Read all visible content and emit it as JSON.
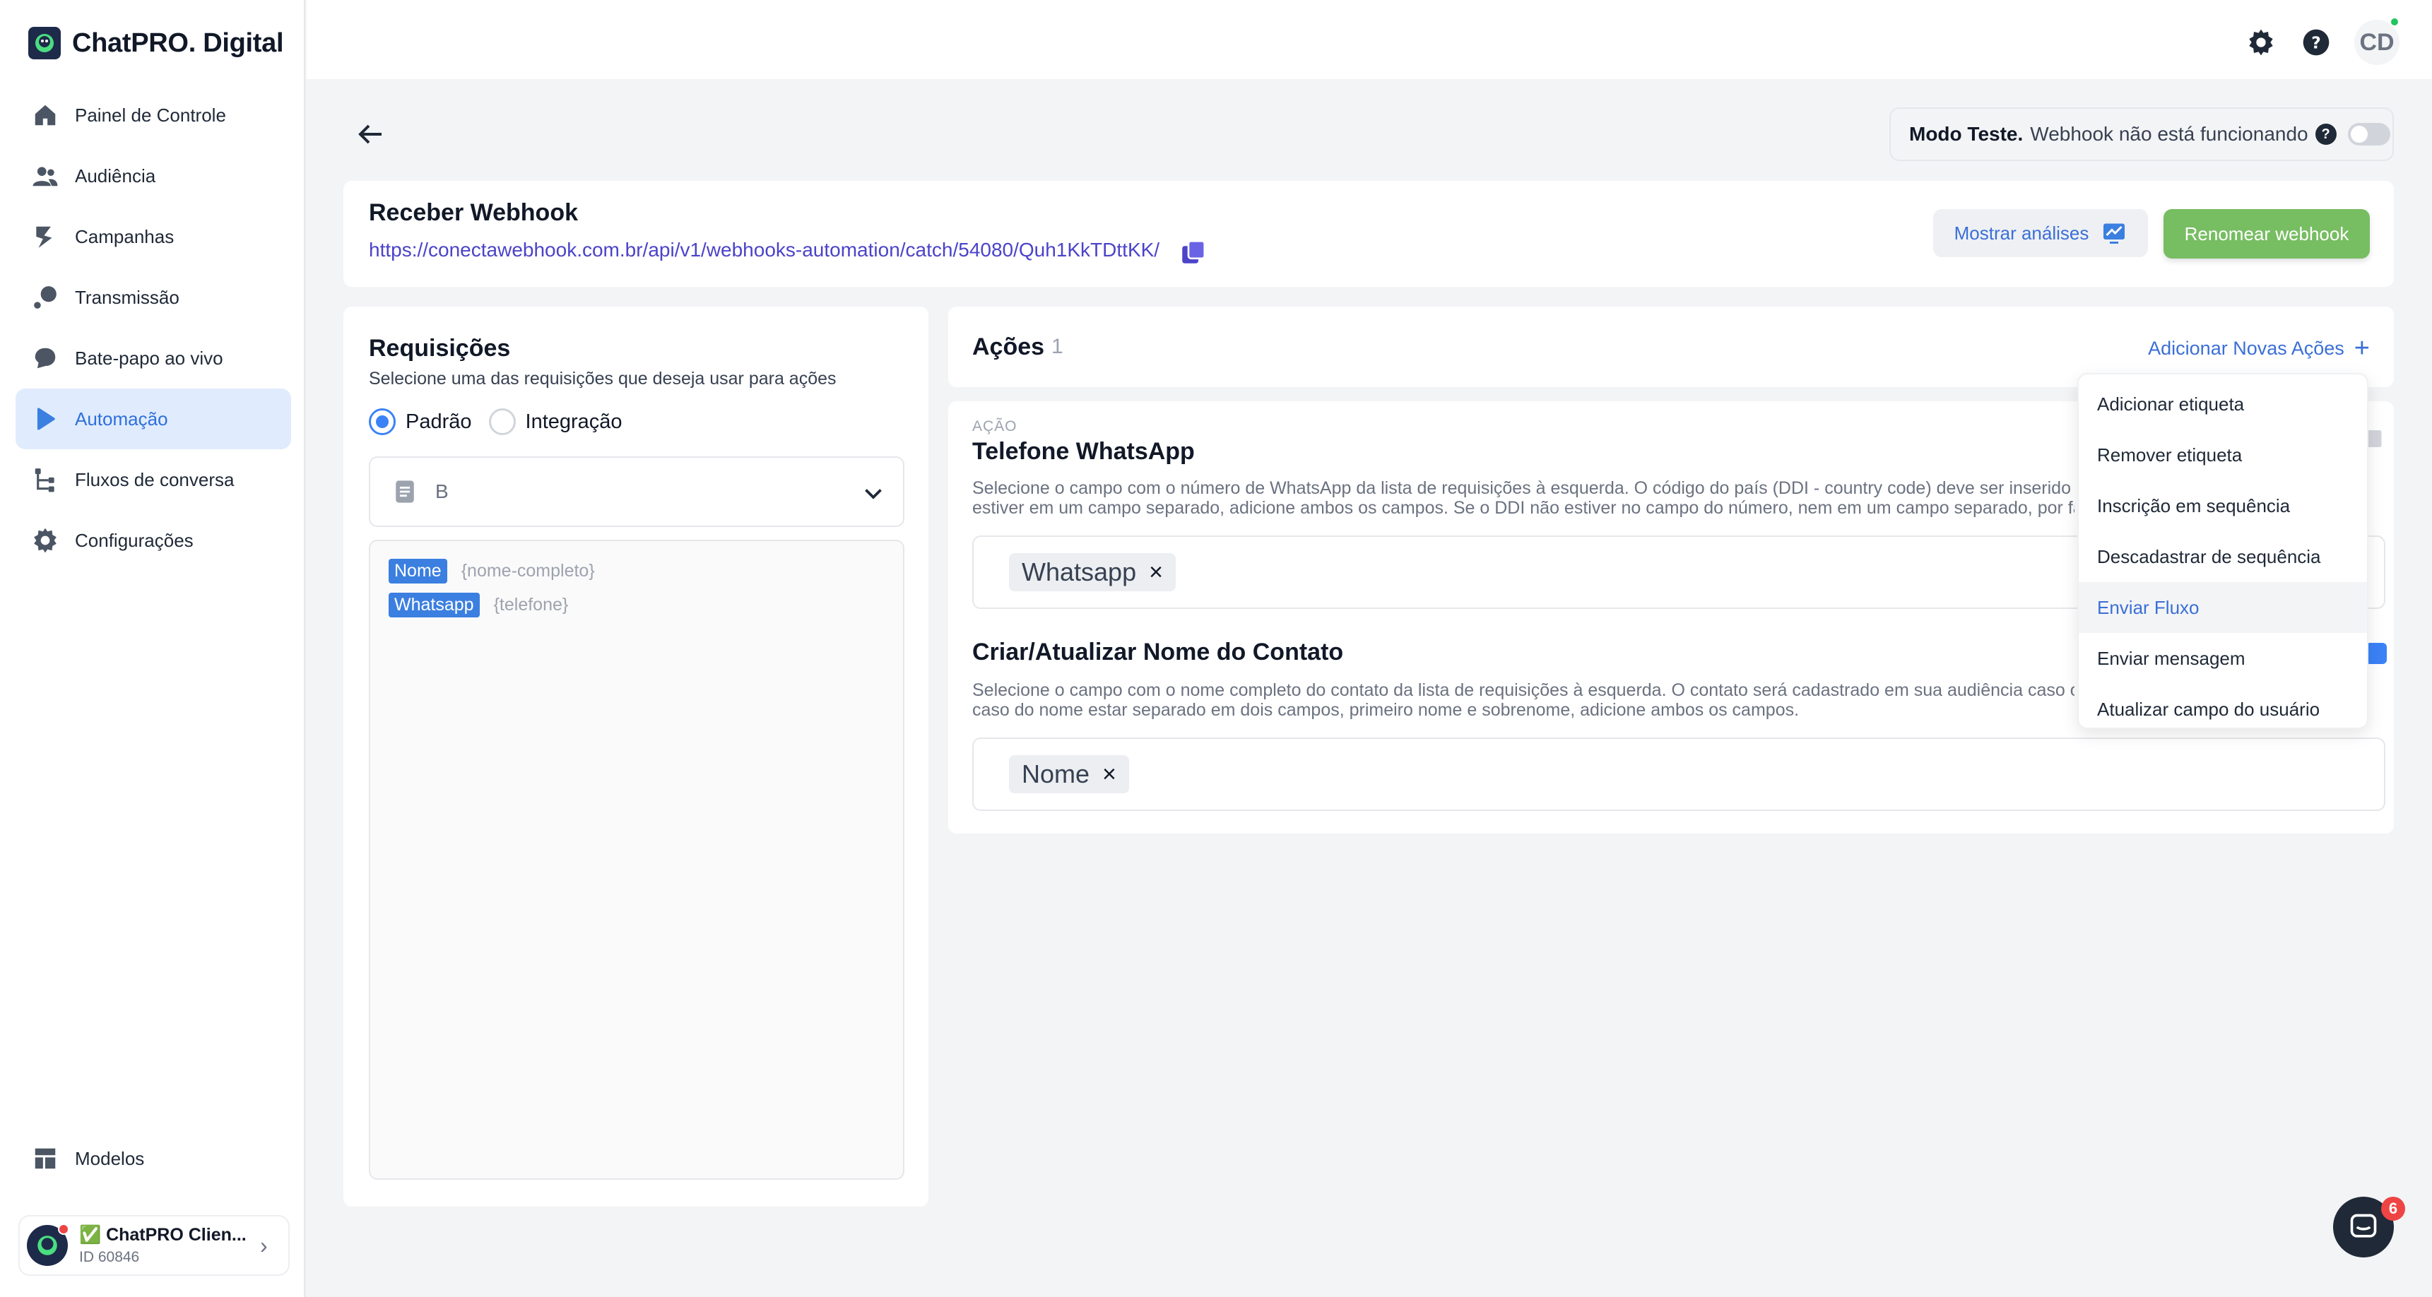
{
  "brand": {
    "name": "ChatPRO. Digital"
  },
  "sidebar": {
    "items": [
      {
        "label": "Painel de Controle",
        "icon": "home-icon"
      },
      {
        "label": "Audiência",
        "icon": "users-icon"
      },
      {
        "label": "Campanhas",
        "icon": "campaign-icon"
      },
      {
        "label": "Transmissão",
        "icon": "broadcast-icon"
      },
      {
        "label": "Bate-papo ao vivo",
        "icon": "chat-bubble-icon"
      },
      {
        "label": "Automação",
        "icon": "play-icon",
        "active": true
      },
      {
        "label": "Fluxos de conversa",
        "icon": "flow-icon"
      },
      {
        "label": "Configurações",
        "icon": "gear-icon"
      }
    ],
    "bottom": {
      "label": "Modelos",
      "icon": "templates-icon"
    },
    "account": {
      "name": "✅ ChatPRO Clien...",
      "id": "ID 60846"
    }
  },
  "header": {
    "user_initials": "CD"
  },
  "test_mode": {
    "label": "Modo Teste.",
    "text": "Webhook não está funcionando"
  },
  "webhook": {
    "title": "Receber Webhook",
    "url": "https://conectawebhook.com.br/api/v1/webhooks-automation/catch/54080/Quh1KkTDttKK/",
    "analytics_label": "Mostrar análises",
    "rename_label": "Renomear webhook"
  },
  "requests": {
    "title": "Requisições",
    "subtitle": "Selecione uma das requisições que deseja usar para ações",
    "options": [
      "Padrão",
      "Integração"
    ],
    "selected_value": "B",
    "fields": [
      {
        "tag": "Nome",
        "var": "{nome-completo}"
      },
      {
        "tag": "Whatsapp",
        "var": "{telefone}"
      }
    ]
  },
  "actions": {
    "title": "Ações",
    "count": "1",
    "add_label": "Adicionar Novas Ações",
    "action_label": "AÇÃO",
    "items": [
      {
        "title": "Telefone WhatsApp",
        "desc1": "Selecione o campo com o número de WhatsApp da lista de requisições à esquerda. O código do país (DDI - country code) deve ser inserido",
        "desc2": "estiver em um campo separado, adicione ambos os campos. Se o DDI não estiver no campo do número, nem em um campo separado, por fa",
        "chip": "Whatsapp"
      },
      {
        "title": "Criar/Atualizar Nome do Contato",
        "desc1": "Selecione o campo com o nome completo do contato da lista de requisições à esquerda. O contato será cadastrado em sua audiência caso o",
        "desc2": "caso do nome estar separado em dois campos, primeiro nome e sobrenome, adicione ambos os campos.",
        "chip": "Nome"
      }
    ]
  },
  "dropdown": {
    "items": [
      "Adicionar etiqueta",
      "Remover etiqueta",
      "Inscrição em sequência",
      "Descadastrar de sequência",
      "Enviar Fluxo",
      "Enviar mensagem",
      "Atualizar campo do usuário"
    ],
    "hovered_index": 4
  },
  "chat": {
    "badge": "6"
  },
  "colors": {
    "accent": "#3b6fd6",
    "active_bg": "#e0ecfd",
    "success": "#77bd62",
    "url": "#4b43c9"
  }
}
